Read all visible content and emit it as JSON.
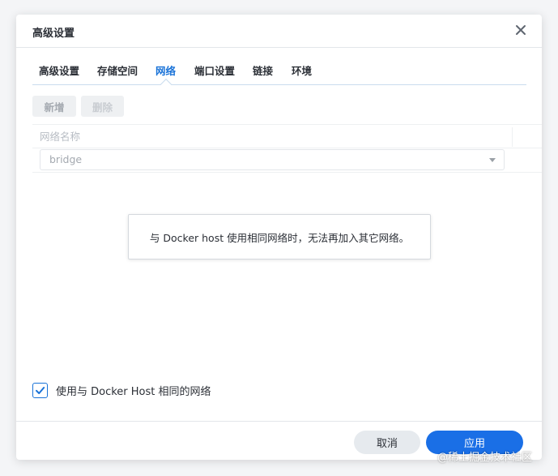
{
  "dialog": {
    "title": "高级设置",
    "close_icon": "close-icon"
  },
  "tabs": [
    {
      "label": "高级设置",
      "active": false
    },
    {
      "label": "存储空间",
      "active": false
    },
    {
      "label": "网络",
      "active": true
    },
    {
      "label": "端口设置",
      "active": false
    },
    {
      "label": "链接",
      "active": false
    },
    {
      "label": "环境",
      "active": false
    }
  ],
  "toolbar": {
    "add_label": "新增",
    "delete_label": "删除"
  },
  "network_table": {
    "column_header": "网络名称",
    "rows": [
      {
        "network": "bridge"
      }
    ]
  },
  "tooltip": {
    "text": "与 Docker host 使用相同网络时，无法再加入其它网络。"
  },
  "host_network": {
    "label": "使用与 Docker Host 相同的网络",
    "checked": true
  },
  "footer": {
    "cancel_label": "取消",
    "apply_label": "应用"
  },
  "watermark": {
    "text": "@稀土掘金技术社区"
  },
  "colors": {
    "accent": "#1a73d8",
    "primary_button": "#1a6fe6",
    "secondary_button": "#e6eaee"
  }
}
